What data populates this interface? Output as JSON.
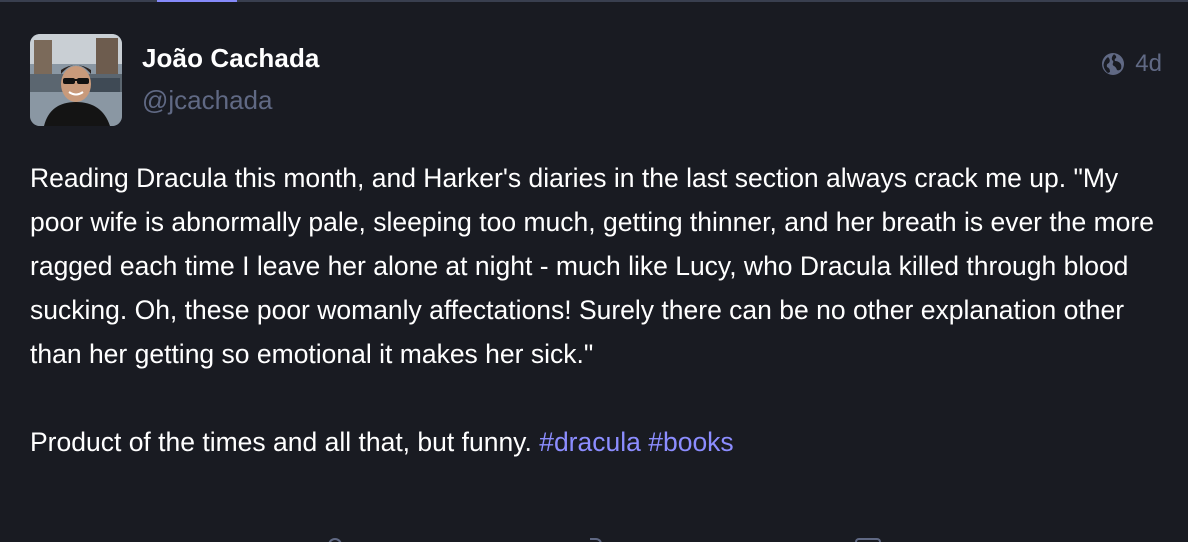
{
  "author": {
    "display_name": "João Cachada",
    "handle": "@jcachada"
  },
  "meta": {
    "visibility_icon": "globe-icon",
    "relative_time": "4d"
  },
  "content": {
    "paragraph_1": "Reading Dracula this month, and Harker's diaries in the last section always crack me up. \"My poor wife is abnormally pale, sleeping too much, getting thinner, and her breath is ever the more ragged each time I leave her alone at night - much like Lucy, who Dracula killed through blood sucking. Oh, these poor womanly affectations! Surely there can be no other explanation other than her getting so emotional it makes her sick.\"",
    "paragraph_2_text": "Product of the times and all that, but funny. ",
    "hashtags": [
      "#dracula",
      "#books"
    ]
  },
  "colors": {
    "background": "#191b22",
    "text": "#ffffff",
    "muted": "#606984",
    "hashtag": "#8c8dff",
    "accent": "#858afa"
  },
  "action_icons": [
    "reply-icon",
    "boost-icon",
    "favourite-icon",
    "bookmark-icon"
  ]
}
